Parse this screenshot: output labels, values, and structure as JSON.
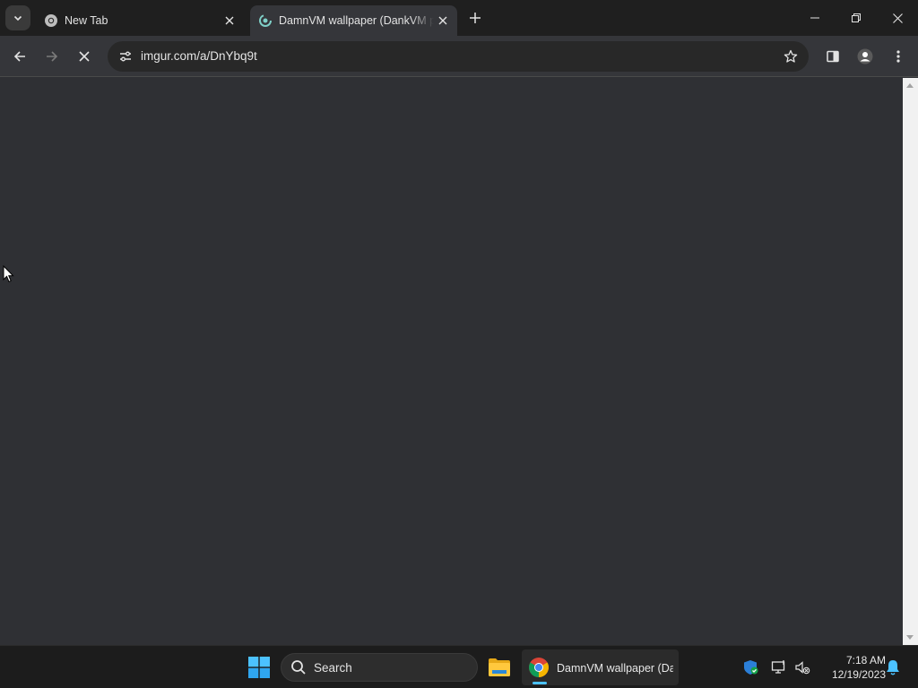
{
  "browser": {
    "tabs": [
      {
        "title": "New Tab",
        "active": false
      },
      {
        "title": "DamnVM wallpaper (DankVM p",
        "active": true
      }
    ],
    "address_bar": {
      "url": "imgur.com/a/DnYbq9t"
    },
    "loading": true
  },
  "taskbar": {
    "search_label": "Search",
    "chrome_window_label": "DamnVM wallpaper (Da",
    "clock": {
      "time": "7:18 AM",
      "date": "12/19/2023"
    }
  },
  "colors": {
    "tabbar_bg": "#1f1f1f",
    "toolbar_bg": "#35363a",
    "content_bg": "#2f3034",
    "taskbar_bg": "#1c1c1c",
    "accent": "#4cc2ff"
  }
}
